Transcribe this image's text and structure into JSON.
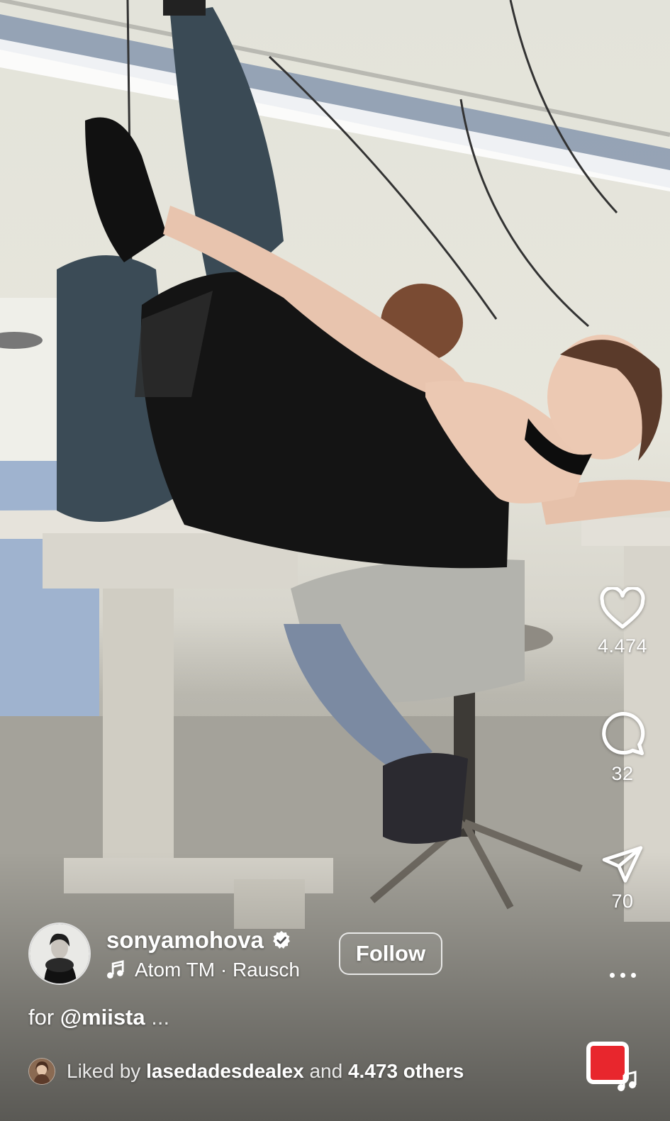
{
  "post": {
    "username": "sonyamohova",
    "verified": true,
    "audio": {
      "artist": "Atom TM",
      "separator": " · ",
      "track": "Rausch"
    },
    "follow_label": "Follow",
    "caption": {
      "prefix": "for ",
      "mention": "@miista",
      "truncation": " ..."
    },
    "liked_by": {
      "prefix": "Liked by ",
      "user": "lasedadesdealex",
      "middle": " and ",
      "count": "4.473 others"
    }
  },
  "actions": {
    "likes": "4.474",
    "comments": "32",
    "shares": "70"
  },
  "icons": {
    "like": "heart-icon",
    "comment": "comment-bubble-icon",
    "share": "paper-plane-icon",
    "more": "more-horizontal-icon",
    "audio": "music-note-icon",
    "verified": "verified-badge-icon",
    "original_audio": "audio-thumbnail-icon"
  },
  "colors": {
    "text": "#ffffff",
    "audio_thumb_red": "#e8262d"
  }
}
